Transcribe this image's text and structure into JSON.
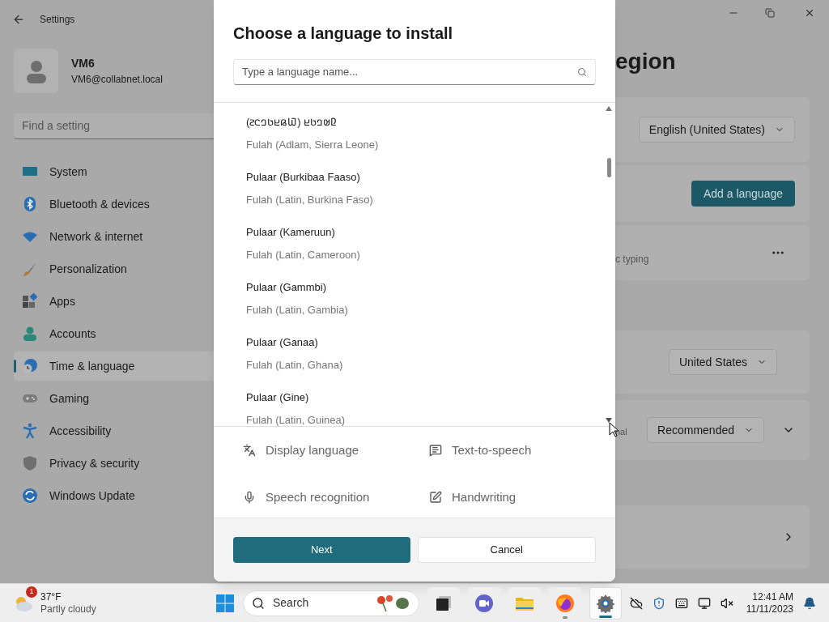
{
  "window": {
    "title": "Settings"
  },
  "account": {
    "name": "VM6",
    "email": "VM6@collabnet.local"
  },
  "search": {
    "placeholder": "Find a setting"
  },
  "nav": [
    {
      "label": "System",
      "selected": false
    },
    {
      "label": "Bluetooth & devices",
      "selected": false
    },
    {
      "label": "Network & internet",
      "selected": false
    },
    {
      "label": "Personalization",
      "selected": false
    },
    {
      "label": "Apps",
      "selected": false
    },
    {
      "label": "Accounts",
      "selected": false
    },
    {
      "label": "Time & language",
      "selected": true
    },
    {
      "label": "Gaming",
      "selected": false
    },
    {
      "label": "Accessibility",
      "selected": false
    },
    {
      "label": "Privacy & security",
      "selected": false
    },
    {
      "label": "Windows Update",
      "selected": false
    }
  ],
  "page": {
    "title": "egion",
    "display_language": "English (United States)",
    "add_button": "Add a language",
    "typing_note": "c typing",
    "region": "United States",
    "format_note": "nal",
    "format": "Recommended"
  },
  "dialog": {
    "title": "Choose a language to install",
    "search": {
      "placeholder": "Type a language name..."
    },
    "languages": [
      {
        "name": "𞤆𞤵𞤤𞤢𞤪 (𞤅𞤫𞤪𞤢𞤤𞤮𞤲)",
        "english": "Fulah (Adlam, Sierra Leone)"
      },
      {
        "name": "Pulaar (Burkibaa Faaso)",
        "english": "Fulah (Latin, Burkina Faso)"
      },
      {
        "name": "Pulaar (Kameruun)",
        "english": "Fulah (Latin, Cameroon)"
      },
      {
        "name": "Pulaar (Gammbi)",
        "english": "Fulah (Latin, Gambia)"
      },
      {
        "name": "Pulaar (Ganaa)",
        "english": "Fulah (Latin, Ghana)"
      },
      {
        "name": "Pulaar (Gine)",
        "english": "Fulah (Latin, Guinea)"
      }
    ],
    "features": [
      {
        "kind": "display",
        "label": "Display language"
      },
      {
        "kind": "tts",
        "label": "Text-to-speech"
      },
      {
        "kind": "speech",
        "label": "Speech recognition"
      },
      {
        "kind": "handwriting",
        "label": "Handwriting"
      }
    ],
    "buttons": [
      {
        "kind": "primary",
        "label": "Next"
      },
      {
        "kind": "secondary",
        "label": "Cancel"
      }
    ]
  },
  "taskbar": {
    "weather": {
      "badge": "1",
      "temperature": "37°F",
      "condition": "Partly cloudy"
    },
    "search": {
      "placeholder": "Search"
    },
    "apps": [
      {
        "kind": "terminal",
        "selected": false,
        "running": false
      },
      {
        "kind": "chat",
        "selected": false,
        "running": false
      },
      {
        "kind": "folder",
        "selected": false,
        "running": false
      },
      {
        "kind": "browser",
        "selected": false,
        "running": true
      },
      {
        "kind": "settings",
        "selected": true,
        "running": true
      }
    ],
    "time": "12:41 AM",
    "date": "11/11/2023"
  }
}
